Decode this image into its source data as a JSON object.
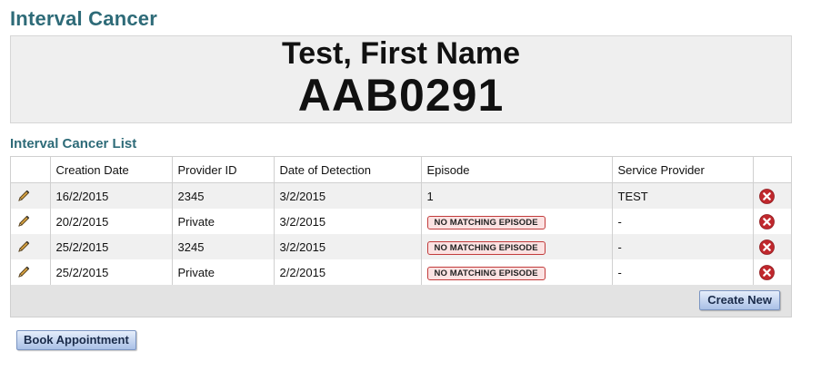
{
  "page": {
    "title": "Interval Cancer"
  },
  "patient": {
    "name": "Test, First Name",
    "id": "AAB0291"
  },
  "list": {
    "title": "Interval Cancer List",
    "columns": [
      "Creation Date",
      "Provider ID",
      "Date of Detection",
      "Episode",
      "Service Provider"
    ],
    "rows": [
      {
        "creation_date": "16/2/2015",
        "provider_id": "2345",
        "date_of_detection": "3/2/2015",
        "episode": "1",
        "episode_badge": false,
        "service_provider": "TEST"
      },
      {
        "creation_date": "20/2/2015",
        "provider_id": "Private",
        "date_of_detection": "3/2/2015",
        "episode": "NO MATCHING EPISODE",
        "episode_badge": true,
        "service_provider": "-"
      },
      {
        "creation_date": "25/2/2015",
        "provider_id": "3245",
        "date_of_detection": "3/2/2015",
        "episode": "NO MATCHING EPISODE",
        "episode_badge": true,
        "service_provider": "-"
      },
      {
        "creation_date": "25/2/2015",
        "provider_id": "Private",
        "date_of_detection": "2/2/2015",
        "episode": "NO MATCHING EPISODE",
        "episode_badge": true,
        "service_provider": "-"
      }
    ],
    "create_label": "Create New"
  },
  "actions": {
    "book_label": "Book Appointment"
  },
  "icons": {
    "edit": "pencil-icon",
    "delete": "delete-icon"
  },
  "colors": {
    "heading": "#2e6b78",
    "delete": "#c0282d",
    "badge_border": "#c23b3b",
    "badge_bg": "#fbe2e2",
    "button_border": "#7b95c2"
  }
}
